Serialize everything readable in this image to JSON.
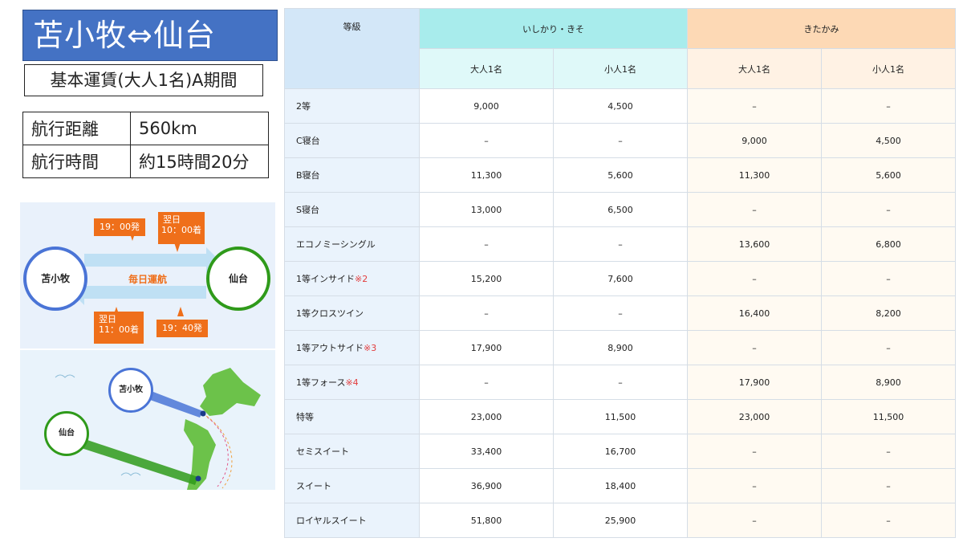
{
  "title": "苫小牧⇔仙台",
  "subtitle": "基本運賃(大人1名)A期間",
  "info": [
    {
      "label": "航行距離",
      "value": "560km"
    },
    {
      "label": "航行時間",
      "value": "約15時間20分"
    }
  ],
  "schedule": {
    "port_a": "苫小牧",
    "port_b": "仙台",
    "frequency": "毎日運航",
    "out_depart": "19：00発",
    "out_arrive_day": "翌日",
    "out_arrive": "10：00着",
    "back_arrive_day": "翌日",
    "back_arrive": "11：00着",
    "back_depart": "19：40発",
    "color_a": "#4a74d6",
    "color_b": "#2f9a1a",
    "tag_color": "#ef6f1a"
  },
  "map": {
    "label_a": "苫小牧",
    "label_b": "仙台"
  },
  "fare_table": {
    "grade_header": "等級",
    "ships": [
      "いしかり・きそ",
      "きたかみ"
    ],
    "sub_headers": [
      "大人1名",
      "小人1名",
      "大人1名",
      "小人1名"
    ],
    "rows": [
      {
        "grade": "2等",
        "note": "",
        "cells": [
          "9,000",
          "4,500",
          "–",
          "–"
        ]
      },
      {
        "grade": "C寝台",
        "note": "",
        "cells": [
          "–",
          "–",
          "9,000",
          "4,500"
        ]
      },
      {
        "grade": "B寝台",
        "note": "",
        "cells": [
          "11,300",
          "5,600",
          "11,300",
          "5,600"
        ]
      },
      {
        "grade": "S寝台",
        "note": "",
        "cells": [
          "13,000",
          "6,500",
          "–",
          "–"
        ]
      },
      {
        "grade": "エコノミーシングル",
        "note": "",
        "cells": [
          "–",
          "–",
          "13,600",
          "6,800"
        ]
      },
      {
        "grade": "1等インサイド",
        "note": "※2",
        "cells": [
          "15,200",
          "7,600",
          "–",
          "–"
        ]
      },
      {
        "grade": "1等クロスツイン",
        "note": "",
        "cells": [
          "–",
          "–",
          "16,400",
          "8,200"
        ]
      },
      {
        "grade": "1等アウトサイド",
        "note": "※3",
        "cells": [
          "17,900",
          "8,900",
          "–",
          "–"
        ]
      },
      {
        "grade": "1等フォース",
        "note": "※4",
        "cells": [
          "–",
          "–",
          "17,900",
          "8,900"
        ]
      },
      {
        "grade": "特等",
        "note": "",
        "cells": [
          "23,000",
          "11,500",
          "23,000",
          "11,500"
        ]
      },
      {
        "grade": "セミスイート",
        "note": "",
        "cells": [
          "33,400",
          "16,700",
          "–",
          "–"
        ]
      },
      {
        "grade": "スイート",
        "note": "",
        "cells": [
          "36,900",
          "18,400",
          "–",
          "–"
        ]
      },
      {
        "grade": "ロイヤルスイート",
        "note": "",
        "cells": [
          "51,800",
          "25,900",
          "–",
          "–"
        ]
      }
    ]
  }
}
